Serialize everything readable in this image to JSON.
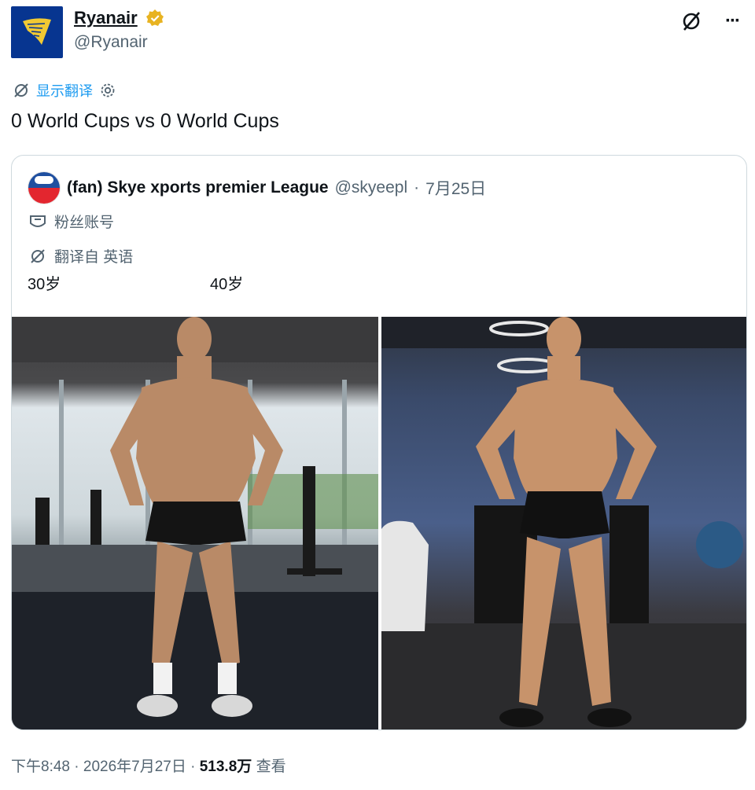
{
  "account": {
    "display_name": "Ryanair",
    "handle": "@Ryanair",
    "avatar_icon": "harp-logo-icon",
    "verified_icon": "verified-badge-icon",
    "brand_color": "#073590",
    "badge_color": "#e8b321"
  },
  "actions": {
    "grok_icon": "grok-icon",
    "more_label": "···"
  },
  "translate": {
    "label": "显示翻译",
    "icon": "translate-icon",
    "settings_icon": "gear-icon"
  },
  "tweet": {
    "text": "0 World Cups vs 0 World Cups"
  },
  "quote": {
    "name": "(fan) Skye xports premier League",
    "handle": "@skyeepl",
    "separator": "·",
    "date": "7月25日",
    "fan_label": "粉丝账号",
    "translated_label": "翻译自 英语",
    "caption_left": "30岁",
    "caption_right": "40岁"
  },
  "meta": {
    "time": "下午8:48",
    "dot1": "·",
    "date": "2026年7月27日",
    "dot2": "·",
    "views": "513.8万",
    "views_label": "查看"
  }
}
